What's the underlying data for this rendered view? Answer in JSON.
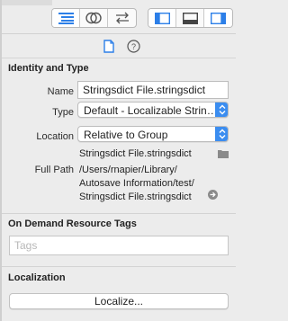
{
  "identity": {
    "section_title": "Identity and Type",
    "name_label": "Name",
    "name_value": "Stringsdict File.stringsdict",
    "type_label": "Type",
    "type_value": "Default - Localizable Strin…",
    "location_label": "Location",
    "location_value": "Relative to Group",
    "relative_path": "Stringsdict File.stringsdict",
    "full_path_label": "Full Path",
    "full_path_lines": [
      "/Users/rnapier/Library/",
      "Autosave Information/test/",
      "Stringsdict File.stringsdict"
    ]
  },
  "on_demand": {
    "section_title": "On Demand Resource Tags",
    "tags_placeholder": "Tags"
  },
  "localization": {
    "section_title": "Localization",
    "localize_button": "Localize..."
  },
  "icons": {
    "toolbar_left": [
      "editor-standard-icon",
      "assistant-editor-icon",
      "version-editor-icon"
    ],
    "toolbar_right": [
      "navigator-panel-icon",
      "debug-area-icon",
      "utilities-panel-icon"
    ],
    "inspector_tabs": [
      "file-inspector-icon",
      "quick-help-icon"
    ]
  },
  "colors": {
    "accent": "#3b8df0",
    "panel_bg": "#ececec"
  }
}
